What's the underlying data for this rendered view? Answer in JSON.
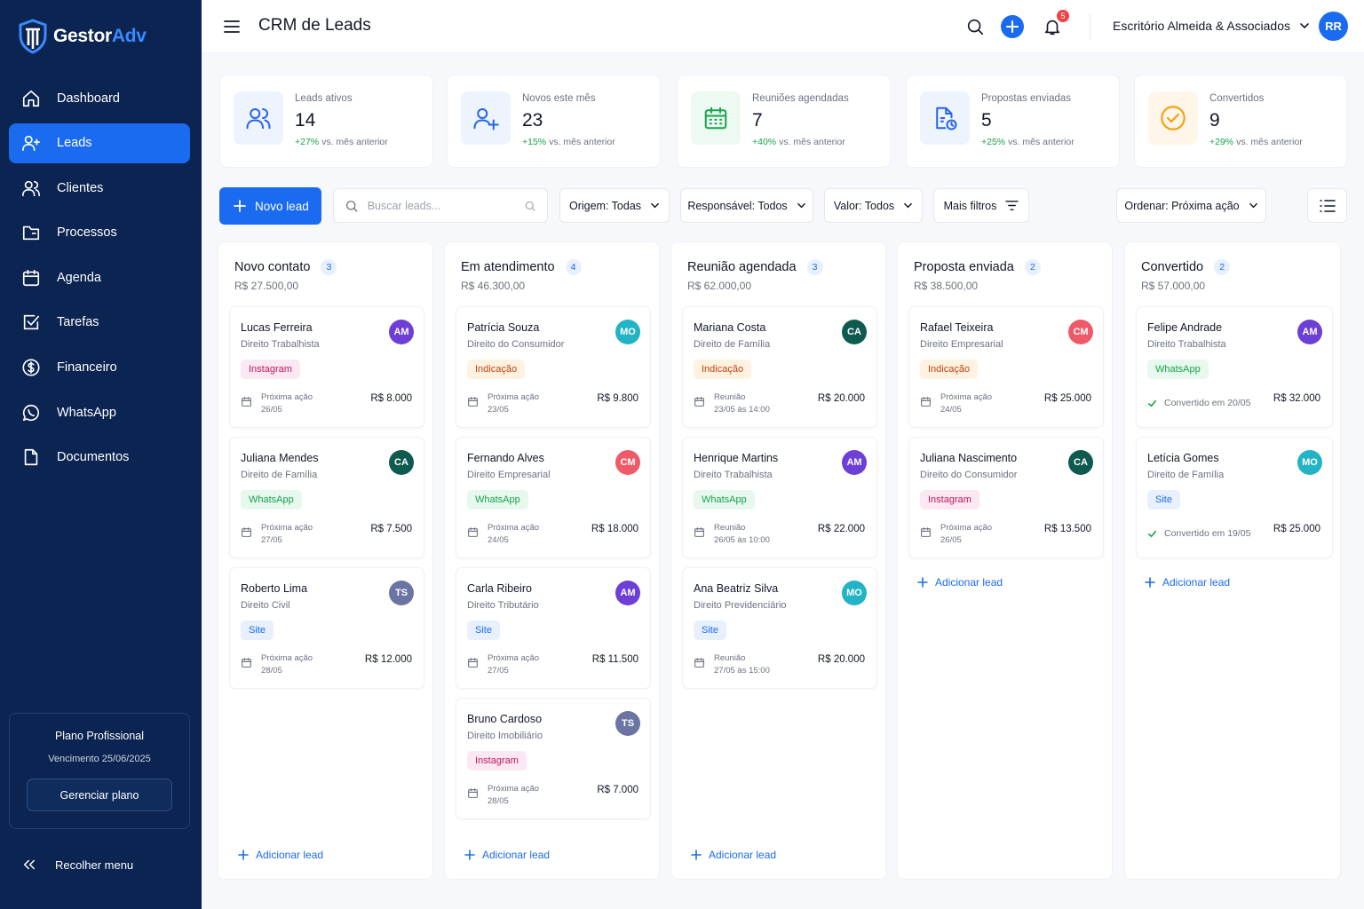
{
  "brand": {
    "part1": "Gestor",
    "part2": "Adv"
  },
  "sidebar": {
    "items": [
      {
        "label": "Dashboard",
        "icon": "home-icon"
      },
      {
        "label": "Leads",
        "icon": "user-plus-icon"
      },
      {
        "label": "Clientes",
        "icon": "users-icon"
      },
      {
        "label": "Processos",
        "icon": "folder-icon"
      },
      {
        "label": "Agenda",
        "icon": "calendar-icon"
      },
      {
        "label": "Tarefas",
        "icon": "checkbox-icon"
      },
      {
        "label": "Financeiro",
        "icon": "dollar-icon"
      },
      {
        "label": "WhatsApp",
        "icon": "whatsapp-icon"
      },
      {
        "label": "Documentos",
        "icon": "document-icon"
      }
    ],
    "active_item": "Leads",
    "plan": {
      "name": "Plano Profissional",
      "due": "Vencimento 25/06/2025",
      "button": "Gerenciar plano"
    },
    "collapse_label": "Recolher menu"
  },
  "header": {
    "title": "CRM de Leads",
    "notifications": "5",
    "org": "Escritório Almeida & Associados",
    "user_initials": "RR"
  },
  "stats": [
    {
      "label": "Leads ativos",
      "value": "14",
      "delta": "+27%",
      "suffix": "vs. mês anterior"
    },
    {
      "label": "Novos este mês",
      "value": "23",
      "delta": "+15%",
      "suffix": "vs. mês anterior"
    },
    {
      "label": "Reuniões agendadas",
      "value": "7",
      "delta": "+40%",
      "suffix": "vs. mês anterior"
    },
    {
      "label": "Propostas enviadas",
      "value": "5",
      "delta": "+25%",
      "suffix": "vs. mês anterior"
    },
    {
      "label": "Convertidos",
      "value": "9",
      "delta": "+29%",
      "suffix": "vs. mês anterior"
    }
  ],
  "toolbar": {
    "new_lead": "Novo lead",
    "search_placeholder": "Buscar leads...",
    "filter_origem": "Origem: Todas",
    "filter_responsavel": "Responsável: Todos",
    "filter_valor": "Valor: Todos",
    "more_filters": "Mais filtros",
    "sort": "Ordenar: Próxima ação"
  },
  "colors": {
    "primary": "#1a6bf0",
    "sidebar": "#0b2452",
    "success": "#16a34a"
  },
  "add_lead_label": "Adicionar lead",
  "columns": [
    {
      "title": "Novo contato",
      "count": "3",
      "total": "R$ 27.500,00",
      "cards": [
        {
          "name": "Lucas Ferreira",
          "area": "Direito Trabalhista",
          "initials": "AM",
          "source": "Instagram",
          "next_label": "Próxima ação",
          "next_date": "26/05",
          "value": "R$ 8.000"
        },
        {
          "name": "Juliana Mendes",
          "area": "Direito de Família",
          "initials": "CA",
          "source": "WhatsApp",
          "next_label": "Próxima ação",
          "next_date": "27/05",
          "value": "R$ 7.500"
        },
        {
          "name": "Roberto Lima",
          "area": "Direito Civil",
          "initials": "TS",
          "source": "Site",
          "next_label": "Próxima ação",
          "next_date": "28/05",
          "value": "R$ 12.000"
        }
      ]
    },
    {
      "title": "Em atendimento",
      "count": "4",
      "total": "R$ 46.300,00",
      "cards": [
        {
          "name": "Patrícia Souza",
          "area": "Direito do Consumidor",
          "initials": "MO",
          "source": "Indicação",
          "next_label": "Próxima ação",
          "next_date": "23/05",
          "value": "R$ 9.800"
        },
        {
          "name": "Fernando Alves",
          "area": "Direito Empresarial",
          "initials": "CM",
          "source": "WhatsApp",
          "next_label": "Próxima ação",
          "next_date": "24/05",
          "value": "R$ 18.000"
        },
        {
          "name": "Carla Ribeiro",
          "area": "Direito Tributário",
          "initials": "AM",
          "source": "Site",
          "next_label": "Próxima ação",
          "next_date": "27/05",
          "value": "R$ 11.500"
        },
        {
          "name": "Bruno Cardoso",
          "area": "Direito Imobiliário",
          "initials": "TS",
          "source": "Instagram",
          "next_label": "Próxima ação",
          "next_date": "28/05",
          "value": "R$ 7.000"
        }
      ]
    },
    {
      "title": "Reunião agendada",
      "count": "3",
      "total": "R$ 62.000,00",
      "cards": [
        {
          "name": "Mariana Costa",
          "area": "Direito de Família",
          "initials": "CA",
          "source": "Indicação",
          "next_label": "Reunião",
          "next_date": "23/05 às 14:00",
          "value": "R$ 20.000"
        },
        {
          "name": "Henrique Martins",
          "area": "Direito Trabalhista",
          "initials": "AM",
          "source": "WhatsApp",
          "next_label": "Reunião",
          "next_date": "26/05 às 10:00",
          "value": "R$ 22.000"
        },
        {
          "name": "Ana Beatriz Silva",
          "area": "Direito Previdenciário",
          "initials": "MO",
          "source": "Site",
          "next_label": "Reunião",
          "next_date": "27/05 às 15:00",
          "value": "R$ 20.000"
        }
      ]
    },
    {
      "title": "Proposta enviada",
      "count": "2",
      "total": "R$ 38.500,00",
      "cards": [
        {
          "name": "Rafael Teixeira",
          "area": "Direito Empresarial",
          "initials": "CM",
          "source": "Indicação",
          "next_label": "Próxima ação",
          "next_date": "24/05",
          "value": "R$ 25.000"
        },
        {
          "name": "Juliana Nascimento",
          "area": "Direito do Consumidor",
          "initials": "CA",
          "source": "Instagram",
          "next_label": "Próxima ação",
          "next_date": "26/05",
          "value": "R$ 13.500"
        }
      ]
    },
    {
      "title": "Convertido",
      "count": "2",
      "total": "R$ 57.000,00",
      "cards": [
        {
          "name": "Felipe Andrade",
          "area": "Direito Trabalhista",
          "initials": "AM",
          "source": "WhatsApp",
          "converted": "Convertido em 20/05",
          "value": "R$ 32.000"
        },
        {
          "name": "Letícia Gomes",
          "area": "Direito de Família",
          "initials": "MO",
          "source": "Site",
          "converted": "Convertido em 19/05",
          "value": "R$ 25.000"
        }
      ]
    }
  ]
}
